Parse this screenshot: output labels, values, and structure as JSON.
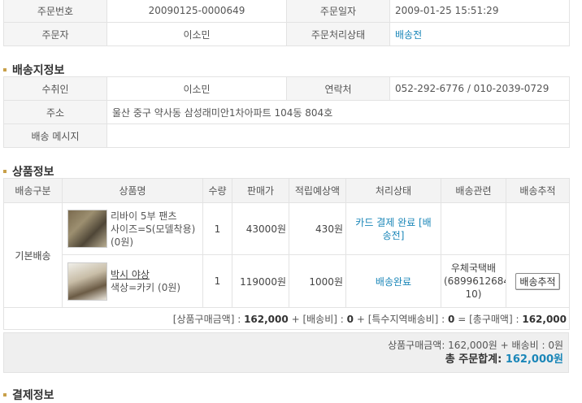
{
  "order": {
    "number_label": "주문번호",
    "number": "20090125-0000649",
    "date_label": "주문일자",
    "date": "2009-01-25 15:51:29",
    "orderer_label": "주문자",
    "orderer": "이소민",
    "status_label": "주문처리상태",
    "status": "배송전"
  },
  "shipping": {
    "title": "배송지정보",
    "recipient_label": "수취인",
    "recipient": "이소민",
    "contact_label": "연락처",
    "contact": "052-292-6776 / 010-2039-0729",
    "address_label": "주소",
    "address": "울산 중구 약사동 삼성래미안1차아파트 104동 804호",
    "message_label": "배송 메시지",
    "message": ""
  },
  "products": {
    "title": "상품정보",
    "headers": [
      "배송구분",
      "상품명",
      "수량",
      "판매가",
      "적립예상액",
      "처리상태",
      "배송관련",
      "배송추적"
    ],
    "group": "기본배송",
    "items": [
      {
        "name": "리바이 5부 팬츠",
        "option": "사이즈=S(모델착용)",
        "option_price": "(0원)",
        "qty": "1",
        "price": "43000원",
        "points": "430원",
        "status_line1": "카드 결제 완료 [배",
        "status_line2": "송전]",
        "delivery_line1": "",
        "delivery_line2": "",
        "tracking": ""
      },
      {
        "name": "박시 야상",
        "option": "색상=카키 (0원)",
        "qty": "1",
        "price": "119000원",
        "points": "1000원",
        "status": "배송완료",
        "delivery_line1": "우체국택배",
        "delivery_line2": "(68996126841",
        "delivery_line3": "10)",
        "tracking": "배송추적"
      }
    ],
    "totals": {
      "goods_label": "[상품구매금액] :",
      "goods": "162,000",
      "plus1": "+",
      "ship_label": "[배송비] :",
      "ship": "0",
      "plus2": "+",
      "special_label": "[특수지역배송비] :",
      "special": "0",
      "eq": "=",
      "total_label": "[총구매액] :",
      "total": "162,000"
    }
  },
  "summary": {
    "line1": "상품구매금액: 162,000원 + 배송비 : 0원",
    "total_label": "총 주문합계:",
    "total": "162,000원"
  },
  "next_section": {
    "title": "결제정보"
  }
}
